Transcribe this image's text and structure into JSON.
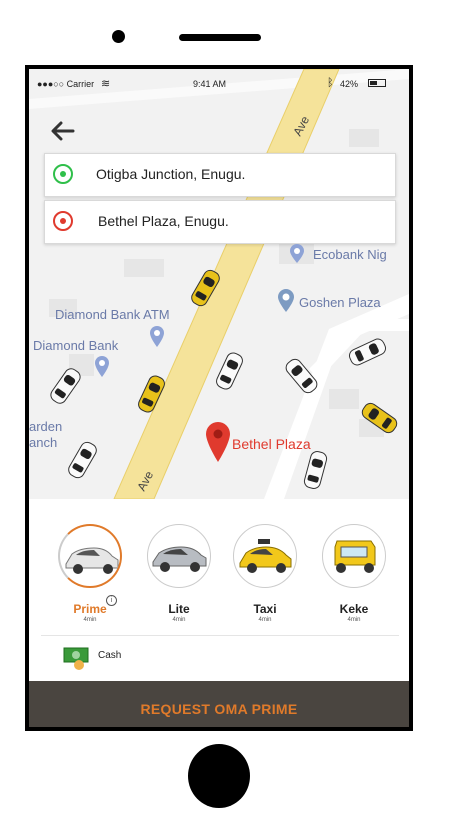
{
  "status_bar": {
    "carrier": "●●●○○ Carrier",
    "time": "9:41 AM",
    "battery": "42%"
  },
  "pickup": {
    "text": "Otigba Junction, Enugu."
  },
  "destination": {
    "text": "Bethel Plaza, Enugu."
  },
  "map": {
    "road_label_top": "Ave",
    "road_label_bottom": "Ave",
    "places": {
      "ecobank": "Ecobank Nig",
      "goshen": "Goshen Plaza",
      "diamond_atm": "Diamond Bank ATM",
      "diamond_bank": "Diamond Bank",
      "garden_line1": "arden",
      "garden_line2": "anch",
      "bethel": "Bethel Plaza"
    }
  },
  "ride_options": [
    {
      "label": "Prime",
      "time": "4min",
      "selected": true
    },
    {
      "label": "Lite",
      "time": "4min"
    },
    {
      "label": "Taxi",
      "time": "4min"
    },
    {
      "label": "Keke",
      "time": "4min"
    }
  ],
  "info_glyph": "i",
  "payment": {
    "label": "Cash"
  },
  "request_button": {
    "label": "REQUEST OMA PRIME"
  },
  "colors": {
    "accent": "#e07a2a",
    "road": "#f5e39a",
    "button_bg": "#4a4540",
    "pin_red": "#e03a2e"
  }
}
